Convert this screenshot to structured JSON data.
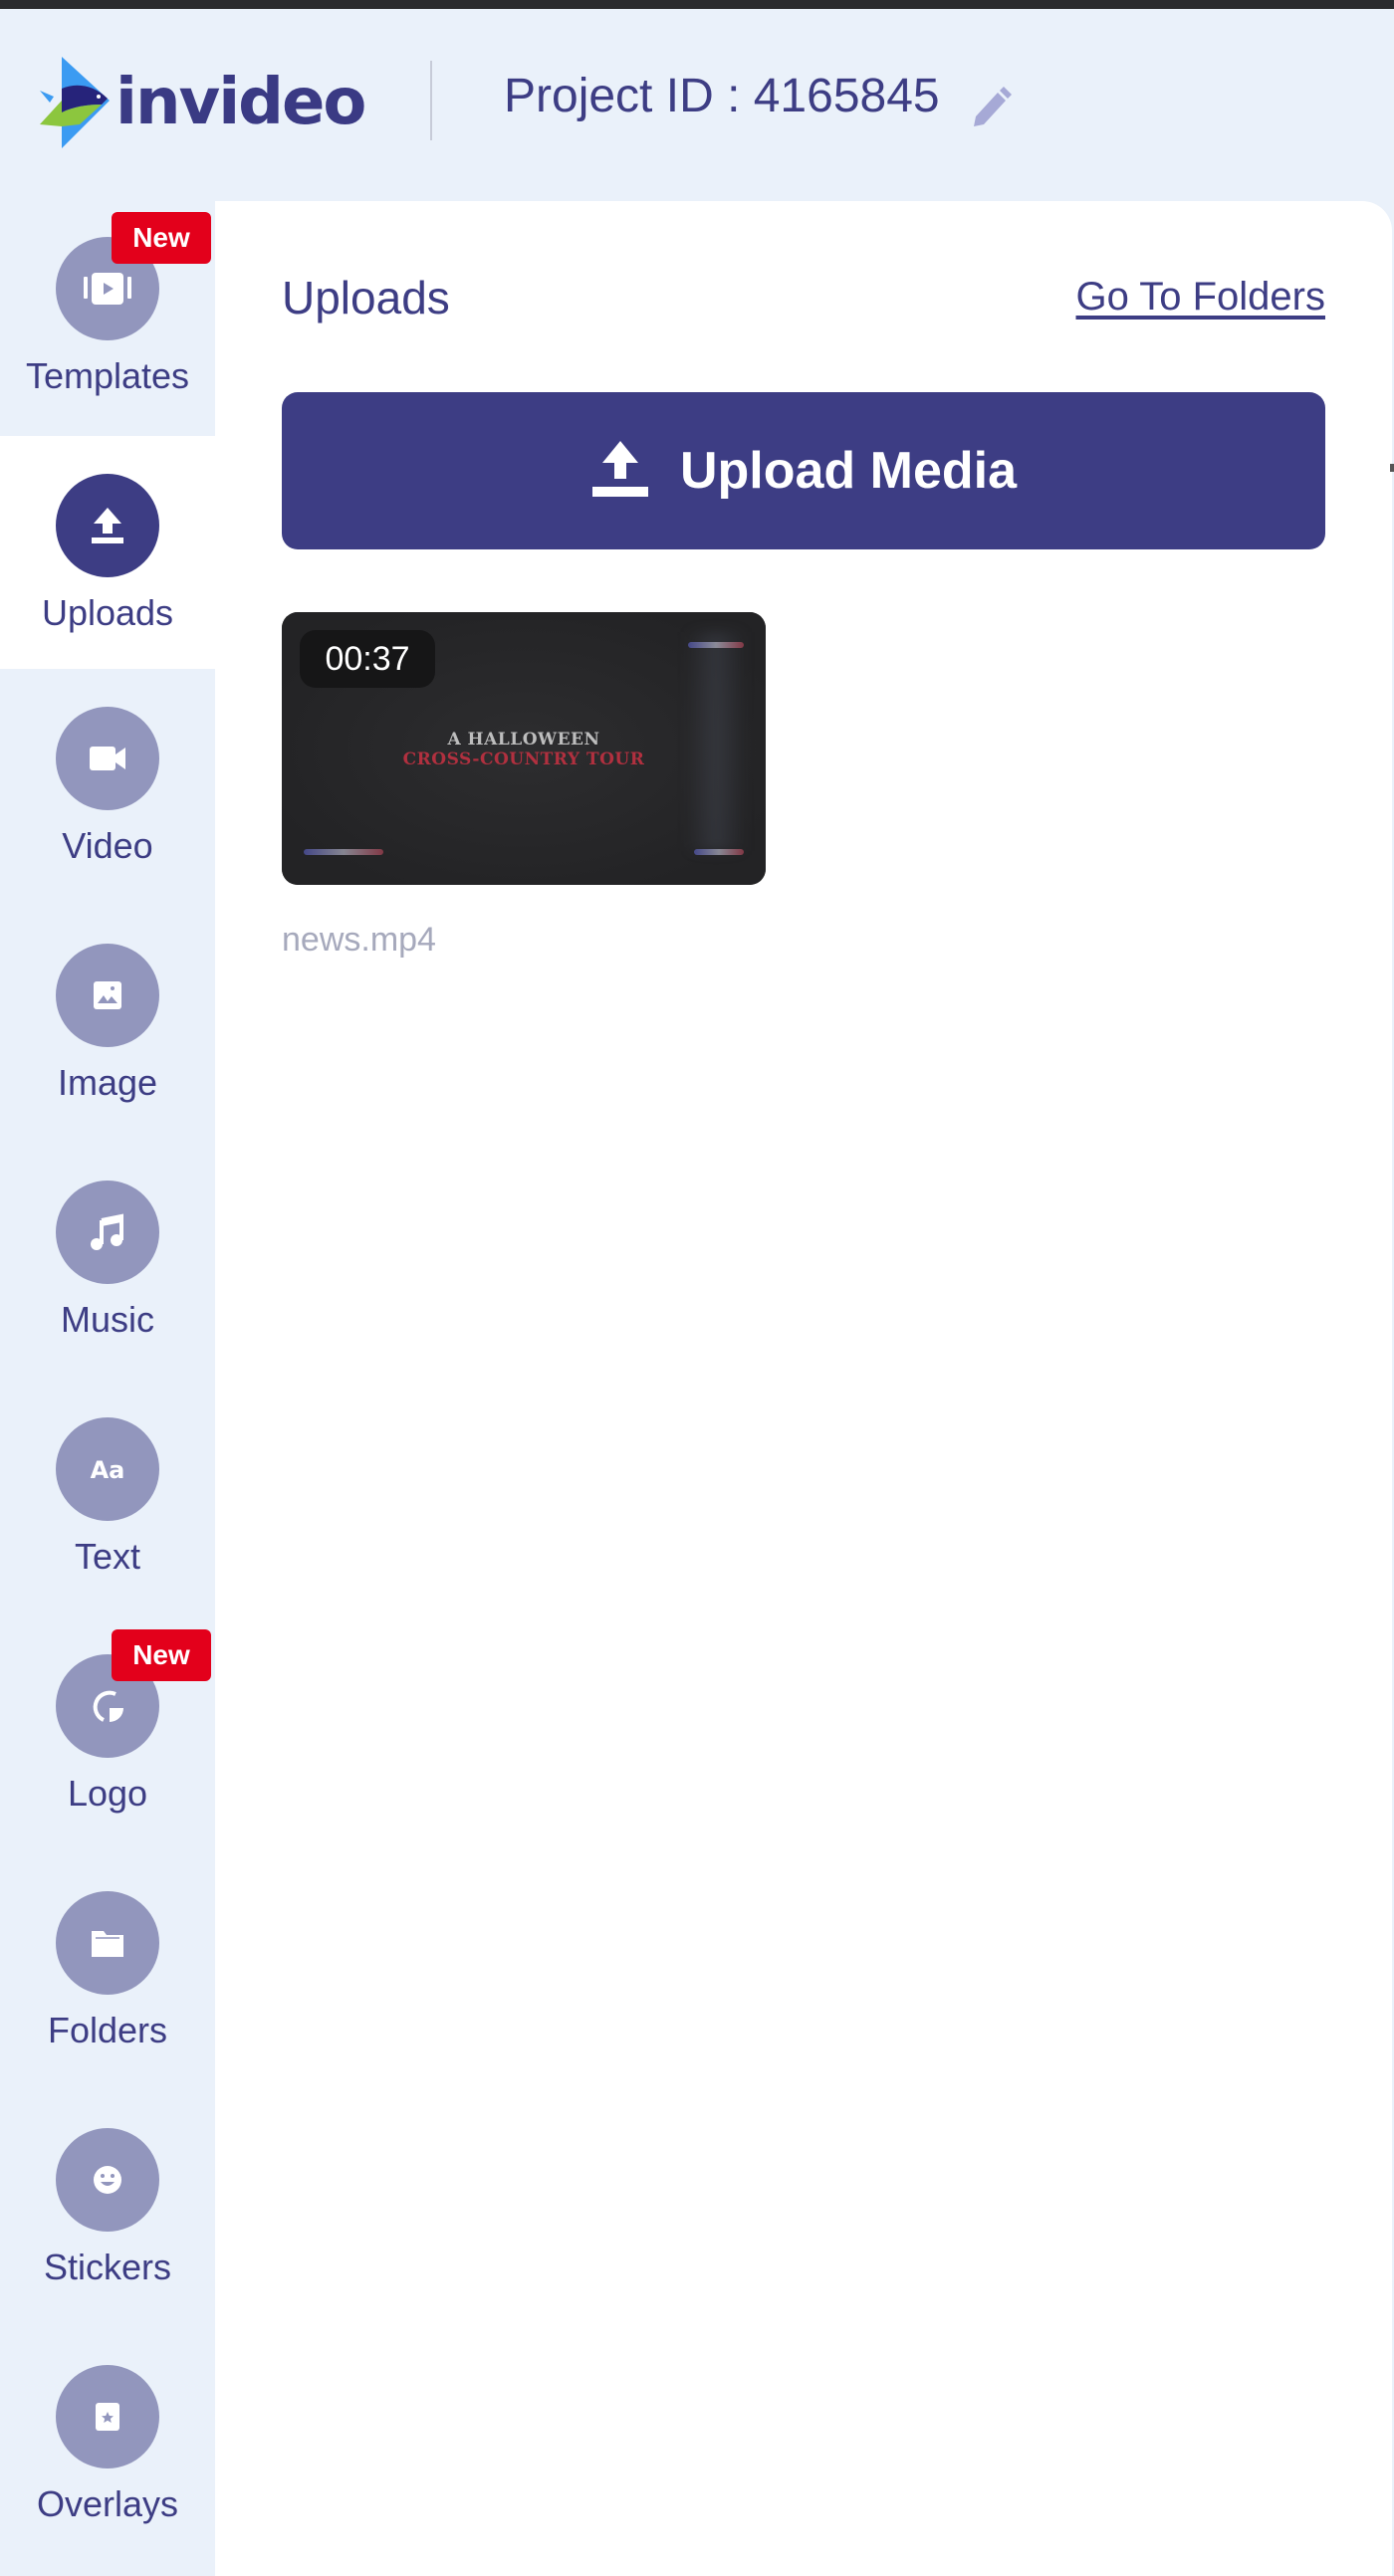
{
  "header": {
    "brand": "invideo",
    "project_id_label": "Project ID : 4165845",
    "edit_icon": "pencil-icon"
  },
  "sidebar": {
    "active": "Uploads",
    "items": [
      {
        "label": "Templates",
        "icon": "template-play-icon",
        "badge": "New"
      },
      {
        "label": "Uploads",
        "icon": "upload-icon",
        "badge": null
      },
      {
        "label": "Video",
        "icon": "video-camera-icon",
        "badge": null
      },
      {
        "label": "Image",
        "icon": "image-icon",
        "badge": null
      },
      {
        "label": "Music",
        "icon": "music-note-icon",
        "badge": null
      },
      {
        "label": "Text",
        "icon": "text-aa-icon",
        "badge": null
      },
      {
        "label": "Logo",
        "icon": "logo-icon",
        "badge": "New"
      },
      {
        "label": "Folders",
        "icon": "folder-icon",
        "badge": null
      },
      {
        "label": "Stickers",
        "icon": "smiley-icon",
        "badge": null
      },
      {
        "label": "Overlays",
        "icon": "overlay-star-icon",
        "badge": null
      }
    ]
  },
  "panel": {
    "title": "Uploads",
    "go_to_folders": "Go To Folders",
    "upload_button": "Upload Media",
    "media": [
      {
        "name": "news.mp4",
        "duration": "00:37",
        "thumbnail_line_1": "A HALLOWEEN",
        "thumbnail_line_2": "CROSS-COUNTRY TOUR"
      }
    ]
  },
  "colors": {
    "primary": "#3d3d84",
    "icon_inactive": "#9296bd",
    "badge_red": "#e3001b",
    "background": "#eaf1fa",
    "panel": "#ffffff"
  }
}
